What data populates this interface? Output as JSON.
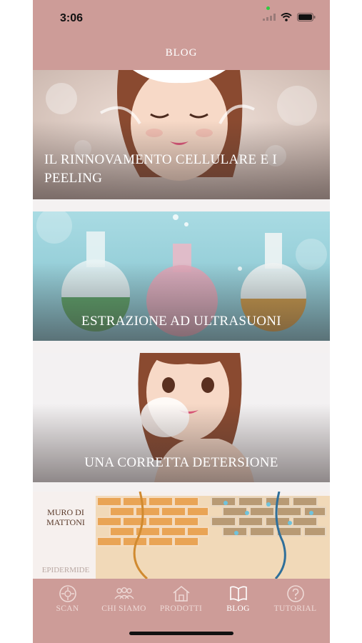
{
  "status": {
    "time": "3:06"
  },
  "header": {
    "title": "BLOG"
  },
  "articles": [
    {
      "title": "IL RINNOVAMENTO CELLULARE E I PEELING"
    },
    {
      "title": "ESTRAZIONE AD ULTRASUONI"
    },
    {
      "title": "UNA CORRETTA DETERSIONE"
    },
    {
      "label_top": "MURO DI MATTONI",
      "label_bottom": "EPIDERMIDE"
    }
  ],
  "tabs": [
    {
      "label": "SCAN",
      "icon": "scan-icon"
    },
    {
      "label": "CHI SIAMO",
      "icon": "people-icon"
    },
    {
      "label": "PRODOTTI",
      "icon": "home-icon"
    },
    {
      "label": "BLOG",
      "icon": "book-icon",
      "active": true
    },
    {
      "label": "TUTORIAL",
      "icon": "question-icon"
    }
  ],
  "colors": {
    "brand": "#cd9c98",
    "tab_inactive": "#eed9d6",
    "tab_active": "#ffffff"
  }
}
